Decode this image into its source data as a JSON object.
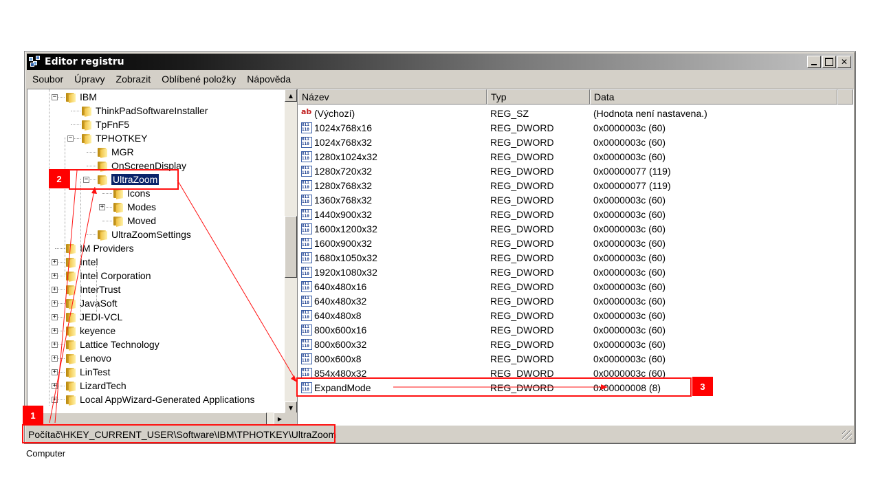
{
  "window": {
    "title": "Editor registru",
    "minimize": "_",
    "close": "✕"
  },
  "menu": {
    "items": [
      {
        "label": "Soubor"
      },
      {
        "label": "Úpravy"
      },
      {
        "label": "Zobrazit"
      },
      {
        "label": "Oblíbené položky"
      },
      {
        "label": "Nápověda"
      }
    ]
  },
  "tree": {
    "items": [
      {
        "label": "IBM",
        "expander": "−"
      },
      {
        "label": "ThinkPadSoftwareInstaller",
        "expander": ""
      },
      {
        "label": "TpFnF5",
        "expander": ""
      },
      {
        "label": "TPHOTKEY",
        "expander": "−"
      },
      {
        "label": "MGR",
        "expander": ""
      },
      {
        "label": "OnScreenDisplay",
        "expander": ""
      },
      {
        "label": "UltraZoom",
        "expander": "−"
      },
      {
        "label": "Icons",
        "expander": ""
      },
      {
        "label": "Modes",
        "expander": "+"
      },
      {
        "label": "Moved",
        "expander": ""
      },
      {
        "label": "UltraZoomSettings",
        "expander": ""
      },
      {
        "label": "IM Providers",
        "expander": ""
      },
      {
        "label": "Intel",
        "expander": "+"
      },
      {
        "label": "Intel Corporation",
        "expander": "+"
      },
      {
        "label": "InterTrust",
        "expander": "+"
      },
      {
        "label": "JavaSoft",
        "expander": "+"
      },
      {
        "label": "JEDI-VCL",
        "expander": "+"
      },
      {
        "label": "keyence",
        "expander": "+"
      },
      {
        "label": "Lattice Technology",
        "expander": "+"
      },
      {
        "label": "Lenovo",
        "expander": "+"
      },
      {
        "label": "LinTest",
        "expander": "+"
      },
      {
        "label": "LizardTech",
        "expander": "+"
      },
      {
        "label": "Local AppWizard-Generated Applications",
        "expander": "+"
      }
    ]
  },
  "list": {
    "columns": [
      {
        "label": "Název"
      },
      {
        "label": "Typ"
      },
      {
        "label": "Data"
      }
    ],
    "rows": [
      {
        "name": "(Výchozí)",
        "type": "REG_SZ",
        "data": "(Hodnota není nastavena.)",
        "icon": "string-value-icon"
      },
      {
        "name": "1024x768x16",
        "type": "REG_DWORD",
        "data": "0x0000003c (60)",
        "icon": "dword-value-icon"
      },
      {
        "name": "1024x768x32",
        "type": "REG_DWORD",
        "data": "0x0000003c (60)",
        "icon": "dword-value-icon"
      },
      {
        "name": "1280x1024x32",
        "type": "REG_DWORD",
        "data": "0x0000003c (60)",
        "icon": "dword-value-icon"
      },
      {
        "name": "1280x720x32",
        "type": "REG_DWORD",
        "data": "0x00000077 (119)",
        "icon": "dword-value-icon"
      },
      {
        "name": "1280x768x32",
        "type": "REG_DWORD",
        "data": "0x00000077 (119)",
        "icon": "dword-value-icon"
      },
      {
        "name": "1360x768x32",
        "type": "REG_DWORD",
        "data": "0x0000003c (60)",
        "icon": "dword-value-icon"
      },
      {
        "name": "1440x900x32",
        "type": "REG_DWORD",
        "data": "0x0000003c (60)",
        "icon": "dword-value-icon"
      },
      {
        "name": "1600x1200x32",
        "type": "REG_DWORD",
        "data": "0x0000003c (60)",
        "icon": "dword-value-icon"
      },
      {
        "name": "1600x900x32",
        "type": "REG_DWORD",
        "data": "0x0000003c (60)",
        "icon": "dword-value-icon"
      },
      {
        "name": "1680x1050x32",
        "type": "REG_DWORD",
        "data": "0x0000003c (60)",
        "icon": "dword-value-icon"
      },
      {
        "name": "1920x1080x32",
        "type": "REG_DWORD",
        "data": "0x0000003c (60)",
        "icon": "dword-value-icon"
      },
      {
        "name": "640x480x16",
        "type": "REG_DWORD",
        "data": "0x0000003c (60)",
        "icon": "dword-value-icon"
      },
      {
        "name": "640x480x32",
        "type": "REG_DWORD",
        "data": "0x0000003c (60)",
        "icon": "dword-value-icon"
      },
      {
        "name": "640x480x8",
        "type": "REG_DWORD",
        "data": "0x0000003c (60)",
        "icon": "dword-value-icon"
      },
      {
        "name": "800x600x16",
        "type": "REG_DWORD",
        "data": "0x0000003c (60)",
        "icon": "dword-value-icon"
      },
      {
        "name": "800x600x32",
        "type": "REG_DWORD",
        "data": "0x0000003c (60)",
        "icon": "dword-value-icon"
      },
      {
        "name": "800x600x8",
        "type": "REG_DWORD",
        "data": "0x0000003c (60)",
        "icon": "dword-value-icon"
      },
      {
        "name": "854x480x32",
        "type": "REG_DWORD",
        "data": "0x0000003c (60)",
        "icon": "dword-value-icon"
      },
      {
        "name": "ExpandMode",
        "type": "REG_DWORD",
        "data": "0x00000008 (8)",
        "icon": "dword-value-icon"
      }
    ]
  },
  "status": {
    "path": "Počítač\\HKEY_CURRENT_USER\\Software\\IBM\\TPHOTKEY\\UltraZoom"
  },
  "caption": "Computer",
  "annotations": {
    "badge1": "1",
    "badge2": "2",
    "badge3": "3",
    "color": "#ff0000"
  }
}
